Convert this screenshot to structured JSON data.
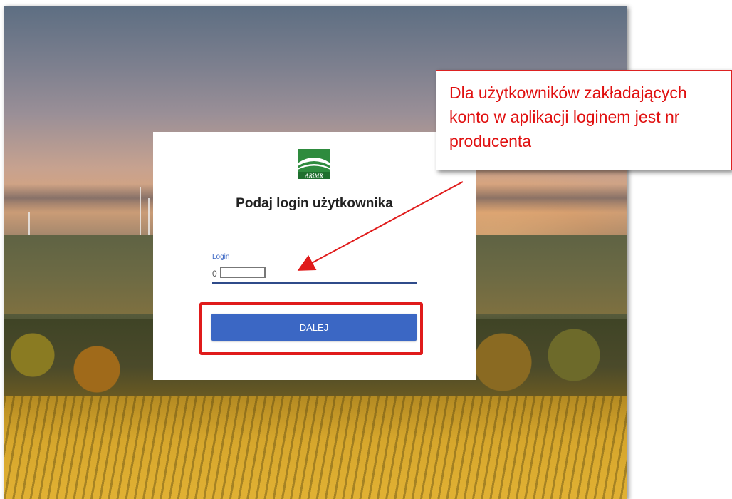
{
  "login_card": {
    "logo_text": "ARiMR",
    "title": "Podaj login użytkownika",
    "login_field": {
      "label": "Login",
      "value": "0"
    },
    "next_button_label": "DALEJ"
  },
  "annotation": {
    "callout_text": "Dla użytkowników zakładających konto w aplikacji loginem jest nr producenta"
  },
  "colors": {
    "primary_button": "#3b67c4",
    "annotation_red": "#e01b1b",
    "logo_green": "#2e8b3e"
  }
}
